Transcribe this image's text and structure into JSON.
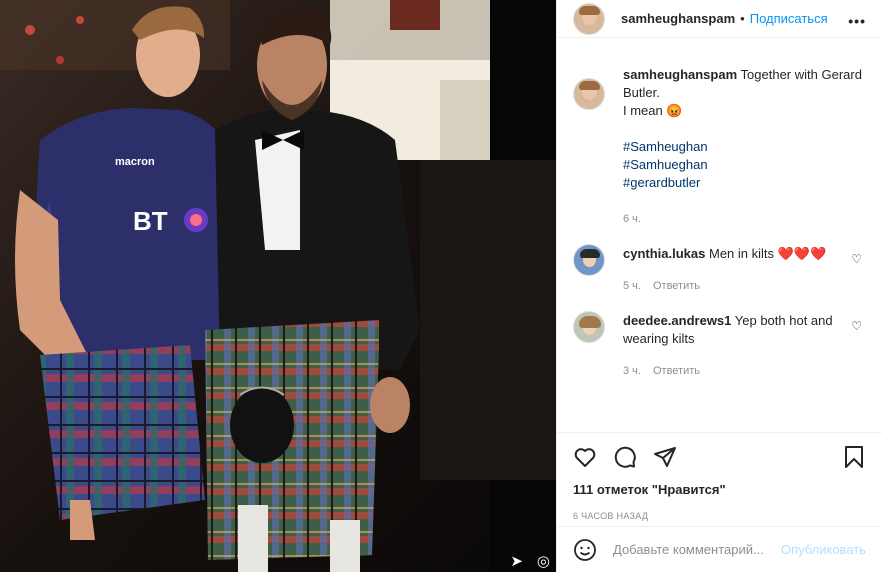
{
  "post": {
    "username": "samheughanspam",
    "follow_label": "Подписаться",
    "separator": "•",
    "more_label": "•••"
  },
  "caption": {
    "username": "samheughanspam",
    "text_line1": "Together with Gerard Butler.",
    "text_line2": "I mean 😡",
    "hashtags": [
      "#Samheughan",
      "#Samhueghan",
      "#gerardbutler"
    ],
    "time": "6 ч."
  },
  "comments": [
    {
      "username": "cynthia.lukas",
      "text": "Men in kilts ❤️❤️❤️",
      "time": "5 ч.",
      "reply_label": "Ответить"
    },
    {
      "username": "deedee.andrews1",
      "text": "Yep both hot and wearing kilts",
      "time": "3 ч.",
      "reply_label": "Ответить"
    }
  ],
  "likes_text": "111 отметок \"Нравится\"",
  "date_text": "6 ЧАСОВ НАЗАД",
  "add_comment": {
    "placeholder": "Добавьте комментарий...",
    "post_label": "Опубликовать"
  },
  "icons": {
    "like": "heart-icon",
    "comment": "comment-icon",
    "share": "share-icon",
    "save": "bookmark-icon",
    "emoji": "emoji-icon"
  }
}
